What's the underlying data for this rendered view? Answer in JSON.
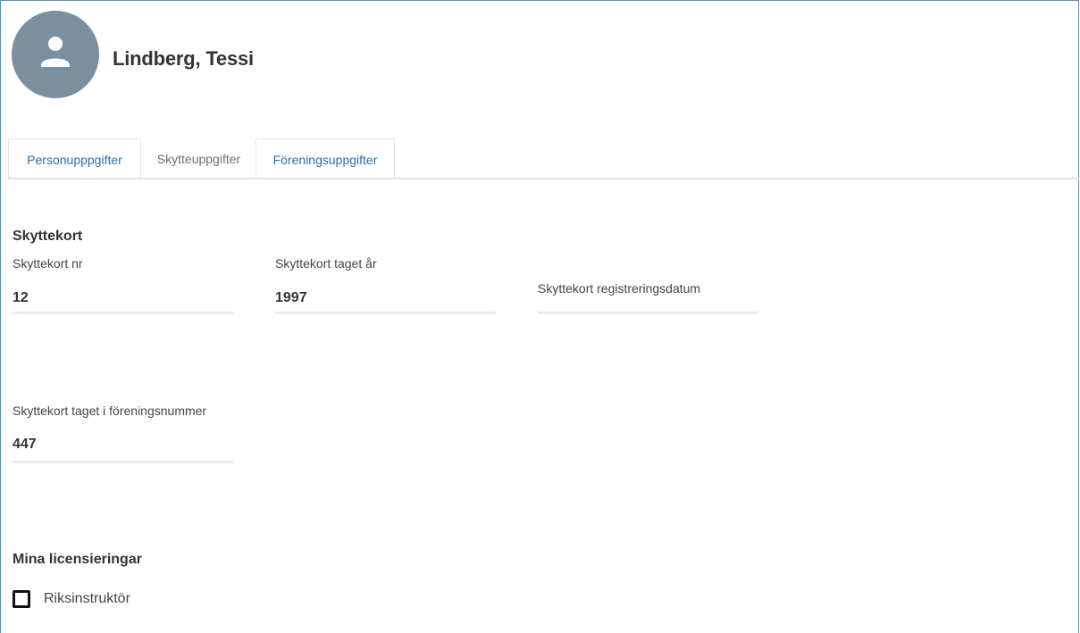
{
  "profile": {
    "name": "Lindberg, Tessi",
    "avatar_icon": "person-icon"
  },
  "tabs": [
    {
      "label": "Personupppgifter",
      "active": false
    },
    {
      "label": "Skytteuppgifter",
      "active": true
    },
    {
      "label": "Föreningsuppgifter",
      "active": false
    }
  ],
  "skyttekort": {
    "title": "Skyttekort",
    "nr_label": "Skyttekort nr",
    "nr_value": "12",
    "year_label": "Skyttekort taget år",
    "year_value": "1997",
    "regdate_label": "Skyttekort registreringsdatum",
    "regdate_value": "",
    "club_label": "Skyttekort taget i föreningsnummer",
    "club_value": "447"
  },
  "licenses": {
    "title": "Mina licensieringar",
    "items": [
      {
        "label": "Riksinstruktör",
        "checked": false
      }
    ]
  },
  "colors": {
    "link": "#2a6fa8",
    "avatar_bg": "#7a8fa0",
    "frame_border": "#5b8fc4"
  }
}
